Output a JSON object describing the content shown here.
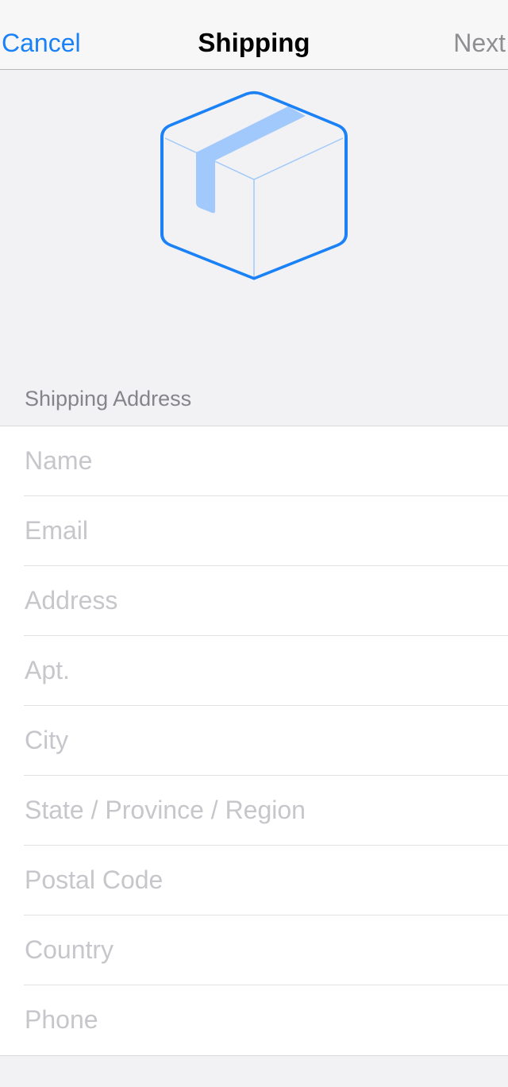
{
  "nav": {
    "cancel_label": "Cancel",
    "title": "Shipping",
    "next_label": "Next"
  },
  "hero": {
    "icon": "package-box-icon"
  },
  "section": {
    "header": "Shipping Address"
  },
  "fields": [
    {
      "placeholder": "Name",
      "value": ""
    },
    {
      "placeholder": "Email",
      "value": ""
    },
    {
      "placeholder": "Address",
      "value": ""
    },
    {
      "placeholder": "Apt.",
      "value": ""
    },
    {
      "placeholder": "City",
      "value": ""
    },
    {
      "placeholder": "State / Province / Region",
      "value": ""
    },
    {
      "placeholder": "Postal Code",
      "value": ""
    },
    {
      "placeholder": "Country",
      "value": ""
    },
    {
      "placeholder": "Phone",
      "value": ""
    }
  ],
  "colors": {
    "accent": "#1a82f6",
    "disabled": "#8e8e93",
    "placeholder": "#c6c6cb",
    "background": "#f2f2f4",
    "tape": "#a1c9fb"
  }
}
